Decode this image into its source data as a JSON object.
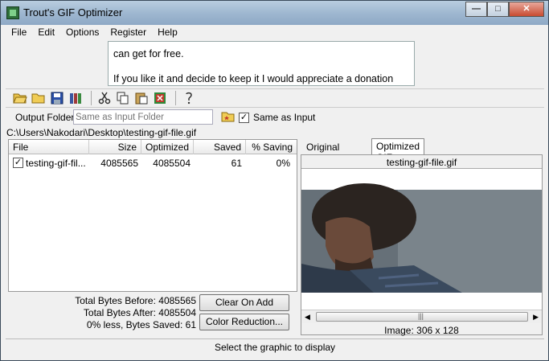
{
  "window": {
    "title": "Trout's GIF Optimizer"
  },
  "menu": [
    "File",
    "Edit",
    "Options",
    "Register",
    "Help"
  ],
  "banner": {
    "lines": [
      "can get for free.",
      "If you like it and decide to keep it I would appreciate a donation"
    ]
  },
  "output_folder": {
    "label": "Output Folder",
    "placeholder": "Same as Input Folder",
    "same_as_input_label": "Same as Input",
    "same_as_input_checked": true
  },
  "path": "C:\\Users\\Nakodari\\Desktop\\testing-gif-file.gif",
  "file_list": {
    "columns": [
      "File",
      "Size",
      "Optimized",
      "Saved",
      "% Saving"
    ],
    "rows": [
      {
        "checked": true,
        "file": "testing-gif-fil...",
        "size": "4085565",
        "optimized": "4085504",
        "saved": "61",
        "saving": "0%"
      }
    ]
  },
  "stats": {
    "before": "Total Bytes Before: 4085565",
    "after": "Total Bytes After: 4085504",
    "saved": "0% less, Bytes Saved: 61"
  },
  "buttons": {
    "clear_on_add": "Clear On Add",
    "color_reduction": "Color Reduction..."
  },
  "tabs": [
    "Original Graphic",
    "Optimized GIF"
  ],
  "preview": {
    "filename": "testing-gif-file.gif",
    "image_size": "Image: 306 x 128"
  },
  "status": "Select the graphic to display"
}
